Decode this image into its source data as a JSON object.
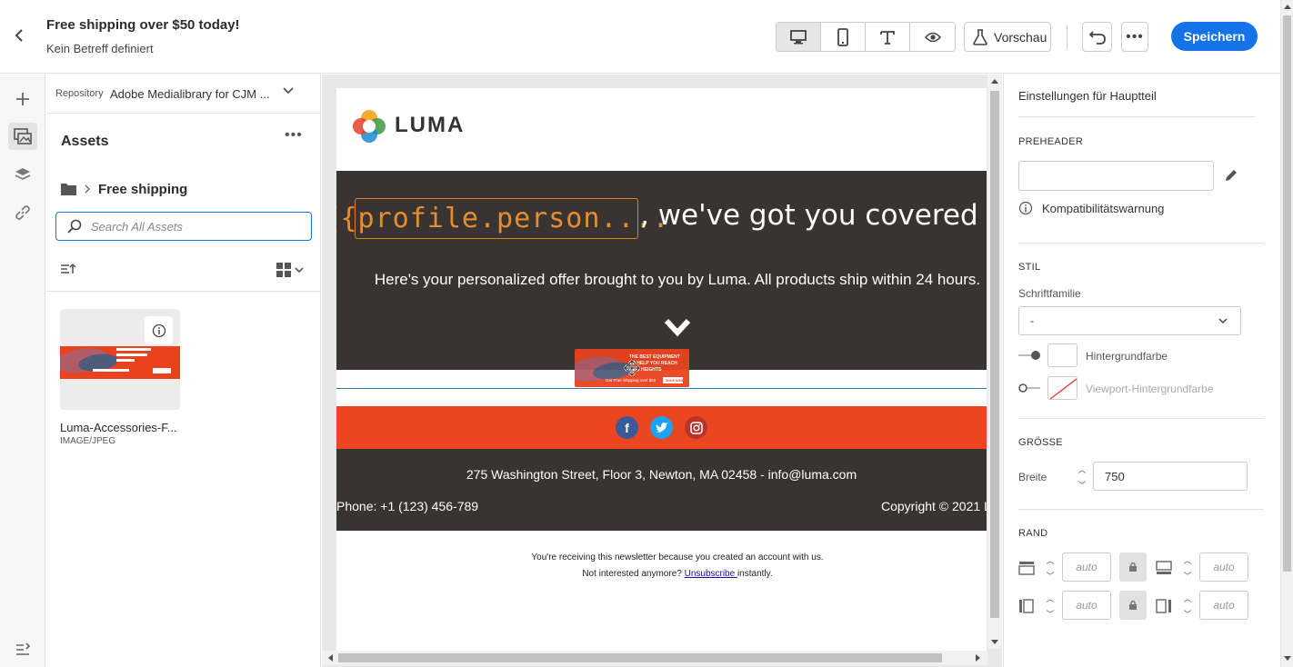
{
  "header": {
    "title": "Free shipping over $50 today!",
    "subtitle": "Kein Betreff definiert",
    "preview_label": "Vorschau",
    "save_label": "Speichern"
  },
  "assets": {
    "repository_label": "Repository",
    "repository_value": "Adobe Medialibrary for CJM ...",
    "heading": "Assets",
    "folder": "Free shipping",
    "search_placeholder": "Search All Assets",
    "items": [
      {
        "name": "Luma-Accessories-F...",
        "type": "IMAGE/JPEG"
      }
    ]
  },
  "email": {
    "logo": "LUMA",
    "token": "{{profile.person....",
    "headline_tail": ", we've got you covered",
    "body": "Here's your personalized offer brought to you by Luma. All products ship within 24 hours.",
    "address": "275 Washington Street, Floor 3, Newton, MA 02458 - info@luma.com",
    "phone": "Phone: +1 (123) 456-789",
    "copyright": "Copyright © 2021 L",
    "legal_line1": "You're receiving this newsletter because you created an account with us.",
    "legal_line2_pre": "Not interested anymore? ",
    "legal_link": "Unsubscribe ",
    "legal_line2_post": "instantly.",
    "banner_line1": "THE BEST EQUIPMENT",
    "banner_line2": "TO HELP YOU REACH",
    "banner_line3": "NEW HEIGHTS",
    "banner_cta": "Get Free Shipping over $50",
    "banner_btn": "SHOP NOW"
  },
  "properties": {
    "title": "Einstellungen für Hauptteil",
    "preheader_section": "PREHEADER",
    "compat_warning": "Kompatibilitätswarnung",
    "style_section": "STIL",
    "font_family_label": "Schriftfamilie",
    "font_family_value": "-",
    "bg_color_label": "Hintergrundfarbe",
    "viewport_bg_label": "Viewport-Hintergrundfarbe",
    "size_section": "GRÖSSE",
    "width_label": "Breite",
    "width_value": "750",
    "margin_section": "RAND",
    "auto": "auto"
  },
  "colors": {
    "accent": "#1473e6",
    "hero_bg": "#393432",
    "social_bg": "#ec4620",
    "token": "#e88d2f"
  }
}
